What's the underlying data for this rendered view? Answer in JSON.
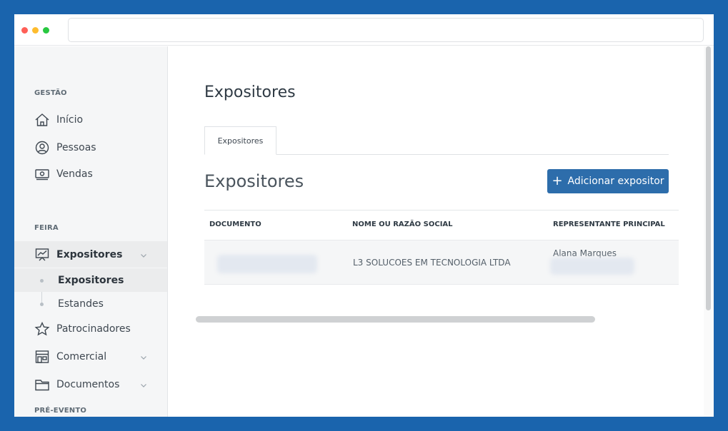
{
  "browser": {
    "url": ""
  },
  "sidebar": {
    "sections": {
      "gestao": "GESTÃO",
      "feira": "FEIRA",
      "pre_evento": "PRÉ-EVENTO"
    },
    "items": {
      "inicio": "Início",
      "pessoas": "Pessoas",
      "vendas": "Vendas",
      "expositores": "Expositores",
      "expositores_sub": "Expositores",
      "estandes": "Estandes",
      "patrocinadores": "Patrocinadores",
      "comercial": "Comercial",
      "documentos": "Documentos"
    }
  },
  "main": {
    "page_title": "Expositores",
    "tab_label": "Expositores",
    "section_title": "Expositores",
    "add_button": "Adicionar expositor",
    "table": {
      "columns": [
        "DOCUMENTO",
        "NOME OU RAZÃO SOCIAL",
        "REPRESENTANTE PRINCIPAL"
      ],
      "rows": [
        {
          "documento": "",
          "nome": "L3 SOLUCOES EM TECNOLOGIA LTDA",
          "representante": "Alana Marques"
        }
      ]
    }
  },
  "colors": {
    "frame": "#1a64ad",
    "primary_button": "#2d6dab",
    "sidebar_bg": "#f5f6f7"
  }
}
